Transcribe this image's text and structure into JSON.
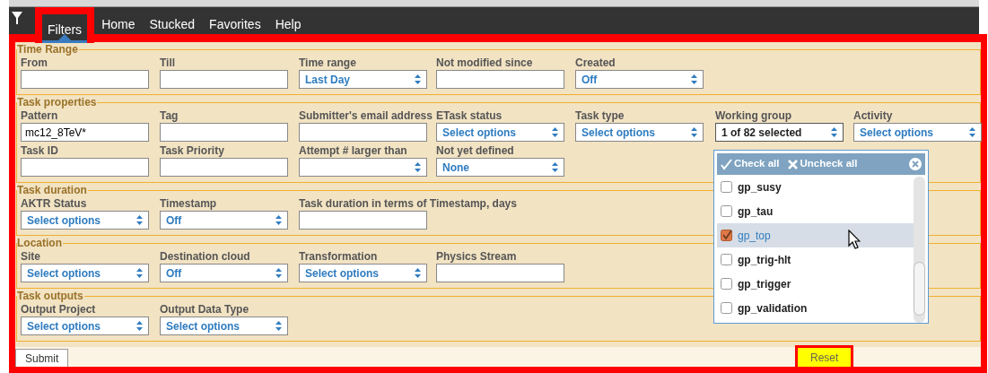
{
  "nav": [
    {
      "label": "Filters",
      "selected": true
    },
    {
      "label": "Home",
      "selected": false
    },
    {
      "label": "Stucked",
      "selected": false
    },
    {
      "label": "Favorites",
      "selected": false
    },
    {
      "label": "Help",
      "selected": false
    }
  ],
  "fieldsets": [
    {
      "legend": "Time Range",
      "rows": [
        [
          {
            "label": "From",
            "kind": "text"
          },
          {
            "label": "Till",
            "kind": "text"
          },
          {
            "label": "Time range",
            "kind": "select",
            "value": "Last Day",
            "open": false
          },
          {
            "label": "Not modified since",
            "kind": "text"
          },
          {
            "label": "Created",
            "kind": "select",
            "value": "Off",
            "open": false
          }
        ]
      ]
    },
    {
      "legend": "Task properties",
      "rows": [
        [
          {
            "label": "Pattern",
            "kind": "text",
            "value": "mc12_8TeV*"
          },
          {
            "label": "Tag",
            "kind": "text"
          },
          {
            "label": "Submitter's email address",
            "kind": "text"
          },
          {
            "label": "ETask status",
            "kind": "select",
            "value": "Select options",
            "open": false
          },
          {
            "label": "Task type",
            "kind": "select",
            "value": "Select options",
            "open": false
          },
          {
            "label": "Working group",
            "kind": "select",
            "value": "1 of 82 selected",
            "open": true
          },
          {
            "label": "Activity",
            "kind": "select",
            "value": "Select options",
            "open": false
          }
        ],
        [
          {
            "label": "Task ID",
            "kind": "text"
          },
          {
            "label": "Task Priority",
            "kind": "text"
          },
          {
            "label": "Attempt # larger than",
            "kind": "select",
            "open": false
          },
          {
            "label": "Not yet defined",
            "kind": "select",
            "value": "None",
            "open": false
          }
        ]
      ]
    },
    {
      "legend": "Task duration",
      "rows": [
        [
          {
            "label": "AKTR Status",
            "kind": "select",
            "value": "Select options",
            "open": false
          },
          {
            "label": "Timestamp",
            "kind": "select",
            "value": "Off",
            "open": false
          },
          {
            "label": "Task duration in terms of Timestamp, days",
            "kind": "text"
          }
        ]
      ]
    },
    {
      "legend": "Location",
      "rows": [
        [
          {
            "label": "Site",
            "kind": "select",
            "value": "Select options",
            "open": false
          },
          {
            "label": "Destination cloud",
            "kind": "select",
            "value": "Off",
            "open": false
          },
          {
            "label": "Transformation",
            "kind": "select",
            "value": "Select options",
            "open": false
          },
          {
            "label": "Physics Stream",
            "kind": "text"
          }
        ]
      ]
    },
    {
      "legend": "Task outputs",
      "rows": [
        [
          {
            "label": "Output Project",
            "kind": "select",
            "value": "Select options",
            "open": false
          },
          {
            "label": "Output Data Type",
            "kind": "select",
            "value": "Select options",
            "open": false
          }
        ]
      ]
    }
  ],
  "dropdown": {
    "check_all": "Check all",
    "uncheck_all": "Uncheck all",
    "options": [
      {
        "label": "gp_susy",
        "checked": false,
        "selected": false
      },
      {
        "label": "gp_tau",
        "checked": false,
        "selected": false
      },
      {
        "label": "gp_top",
        "checked": true,
        "selected": true
      },
      {
        "label": "gp_trig-hlt",
        "checked": false,
        "selected": false
      },
      {
        "label": "gp_trigger",
        "checked": false,
        "selected": false
      },
      {
        "label": "gp_validation",
        "checked": false,
        "selected": false
      }
    ]
  },
  "buttons": {
    "submit": "Submit",
    "reset": "Reset"
  }
}
